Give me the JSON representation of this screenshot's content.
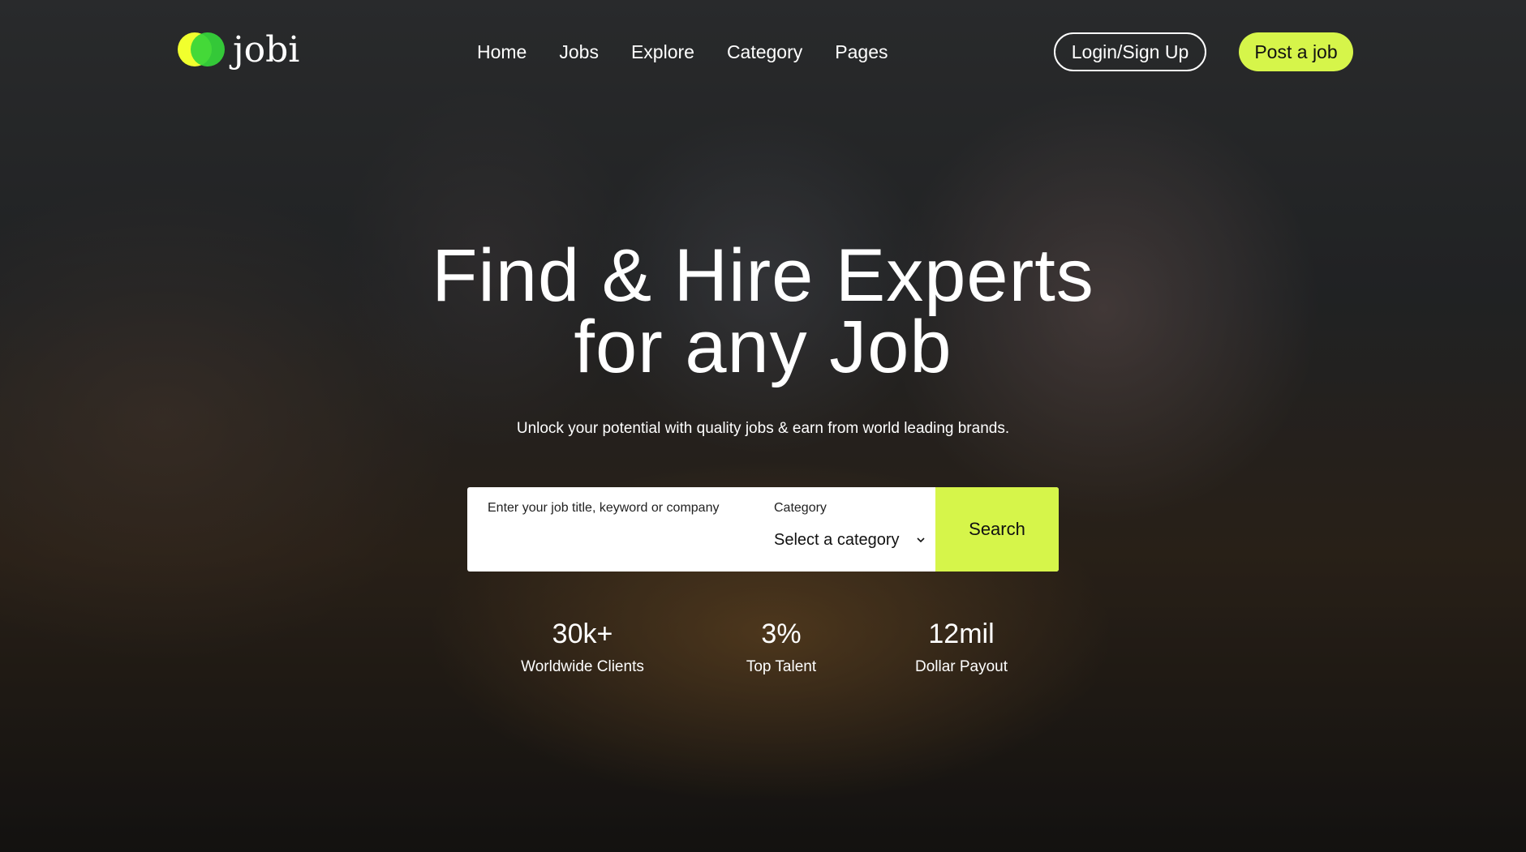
{
  "brand": {
    "name": "jobi",
    "logo_color_1": "#f1ff2e",
    "logo_color_2": "#35d63a",
    "accent": "#d6f54a"
  },
  "nav": {
    "items": [
      {
        "label": "Home"
      },
      {
        "label": "Jobs"
      },
      {
        "label": "Explore"
      },
      {
        "label": "Category"
      },
      {
        "label": "Pages"
      }
    ],
    "login_label": "Login/Sign Up",
    "post_job_label": "Post a job"
  },
  "hero": {
    "headline_line1": "Find & Hire Experts",
    "headline_line2": "for any Job",
    "subtitle": "Unlock your potential with quality jobs & earn from world leading brands."
  },
  "search": {
    "keyword_label": "Enter your job title, keyword or company",
    "keyword_value": "",
    "category_label": "Category",
    "category_selected": "Select a category",
    "button_label": "Search"
  },
  "stats": [
    {
      "value": "30k+",
      "label": "Worldwide Clients"
    },
    {
      "value": "3%",
      "label": "Top Talent"
    },
    {
      "value": "12mil",
      "label": "Dollar Payout"
    }
  ]
}
